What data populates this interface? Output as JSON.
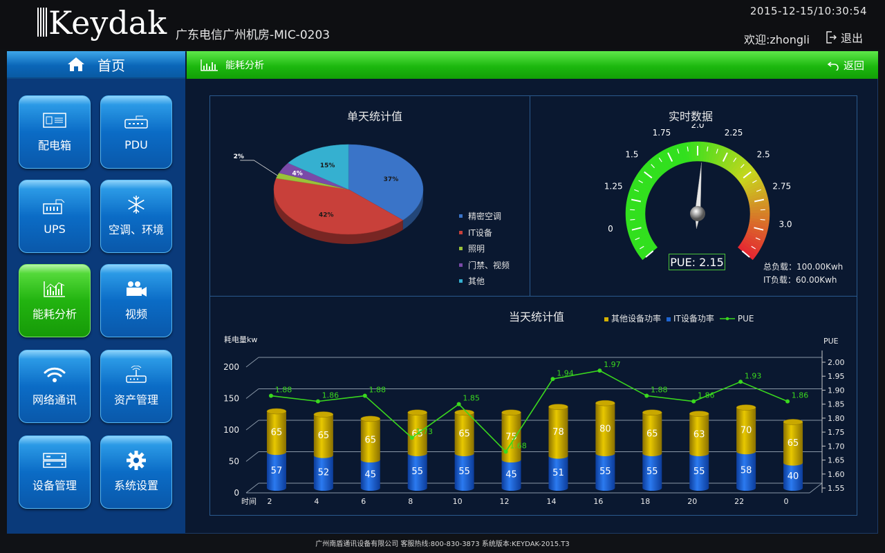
{
  "header": {
    "logo_text": "Keydak",
    "site_name": "广东电信广州机房-MIC-0203",
    "datetime": "2015-12-15/10:30:54",
    "welcome": "欢迎:zhongli",
    "logout_label": "退出"
  },
  "sidebar": {
    "home_label": "首页",
    "items": [
      {
        "label": "配电箱",
        "icon": "distribution-box-icon"
      },
      {
        "label": "PDU",
        "icon": "pdu-icon"
      },
      {
        "label": "UPS",
        "icon": "ups-icon"
      },
      {
        "label": "空调、环境",
        "icon": "snowflake-icon"
      },
      {
        "label": "能耗分析",
        "icon": "bar-chart-icon",
        "active": true
      },
      {
        "label": "视频",
        "icon": "video-camera-icon"
      },
      {
        "label": "网络通讯",
        "icon": "wifi-icon"
      },
      {
        "label": "资产管理",
        "icon": "router-icon"
      },
      {
        "label": "设备管理",
        "icon": "server-icon"
      },
      {
        "label": "系统设置",
        "icon": "gear-icon"
      }
    ]
  },
  "content": {
    "title": "能耗分析",
    "back_label": "返回"
  },
  "pie": {
    "title": "单天统计值",
    "slices": [
      {
        "name": "精密空调",
        "value": 37,
        "label": "37%",
        "color": "#3a74c8"
      },
      {
        "name": "IT设备",
        "value": 42,
        "label": "42%",
        "color": "#c8403a"
      },
      {
        "name": "照明",
        "value": 2,
        "label": "2%",
        "color": "#9ac23a"
      },
      {
        "name": "门禁、视频",
        "value": 4,
        "label": "4%",
        "color": "#7a4aa8"
      },
      {
        "name": "其他",
        "value": 15,
        "label": "15%",
        "color": "#35b0d0"
      }
    ]
  },
  "gauge": {
    "title": "实时数据",
    "min": 0,
    "max": 3.0,
    "value": 2.15,
    "ticks": [
      "0",
      "1.25",
      "1.5",
      "1.75",
      "2.0",
      "2.25",
      "2.5",
      "2.75",
      "3.0"
    ],
    "pue_text": "PUE: 2.15",
    "total_load": "总负载：100.00Kwh",
    "it_load": "IT负载：60.00Kwh"
  },
  "chart_data": {
    "type": "bar",
    "title": "当天统计值",
    "ylabel": "耗电量kw",
    "y2label": "PUE",
    "xlabel": "时间",
    "categories": [
      "2",
      "4",
      "6",
      "8",
      "10",
      "12",
      "14",
      "16",
      "18",
      "20",
      "22",
      "0"
    ],
    "ylim": [
      0,
      200
    ],
    "yticks": [
      "0",
      "50",
      "100",
      "150",
      "200"
    ],
    "y2lim": [
      1.55,
      2.0
    ],
    "y2ticks": [
      "1.55",
      "1.60",
      "1.65",
      "1.70",
      "1.75",
      "1.80",
      "1.85",
      "1.90",
      "1.95",
      "2.00"
    ],
    "series": [
      {
        "name": "IT设备功率",
        "color": "#1e64d0",
        "values": [
          57,
          52,
          45,
          55,
          55,
          45,
          51,
          55,
          55,
          55,
          58,
          40
        ]
      },
      {
        "name": "其他设备功率",
        "color": "#d4b000",
        "values": [
          65,
          65,
          65,
          65,
          65,
          75,
          78,
          80,
          65,
          63,
          70,
          65
        ]
      },
      {
        "name": "PUE",
        "color": "#3ad81e",
        "values": [
          1.88,
          1.86,
          1.88,
          1.73,
          1.85,
          1.68,
          1.94,
          1.97,
          1.88,
          1.86,
          1.93,
          1.86
        ]
      }
    ]
  },
  "footer": {
    "text": "广州南盾通讯设备有限公司 客服热线:800-830-3873 系统版本:KEYDAK-2015.T3"
  }
}
